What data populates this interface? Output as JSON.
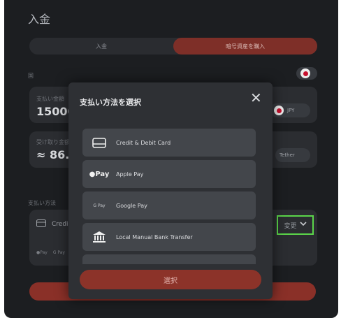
{
  "header": {
    "title": "入金"
  },
  "tabs": [
    {
      "label": "入金",
      "active": false
    },
    {
      "label": "暗号資産を購入",
      "active": true
    }
  ],
  "country": {
    "label": "国"
  },
  "pay_amount": {
    "label": "支払い金額",
    "value": "15000",
    "currency": "JPY"
  },
  "receive_amount": {
    "label": "受け取り金額",
    "value": "≈ 86.9",
    "asset": "Tether"
  },
  "payment_method": {
    "label": "支払い方法",
    "selected": "Credit & Debit Card",
    "selected_visible": "Credi",
    "change_label": "変更",
    "logos": [
      "Pay",
      "G Pay"
    ]
  },
  "modal": {
    "title": "支払い方法を選択",
    "select_label": "選択",
    "methods": [
      {
        "label": "Credit & Debit Card",
        "icon": "card-icon"
      },
      {
        "label": "Apple Pay",
        "icon": "apple-pay-icon",
        "icon_text": "Pay"
      },
      {
        "label": "Google Pay",
        "icon": "google-pay-icon",
        "icon_text": "G Pay"
      },
      {
        "label": "Local Manual Bank Transfer",
        "icon": "bank-icon"
      },
      {
        "label": "",
        "icon": "more-method-icon"
      }
    ]
  },
  "colors": {
    "accent": "#8c3329",
    "highlight": "#5bd64a",
    "background": "#1c1e21"
  }
}
